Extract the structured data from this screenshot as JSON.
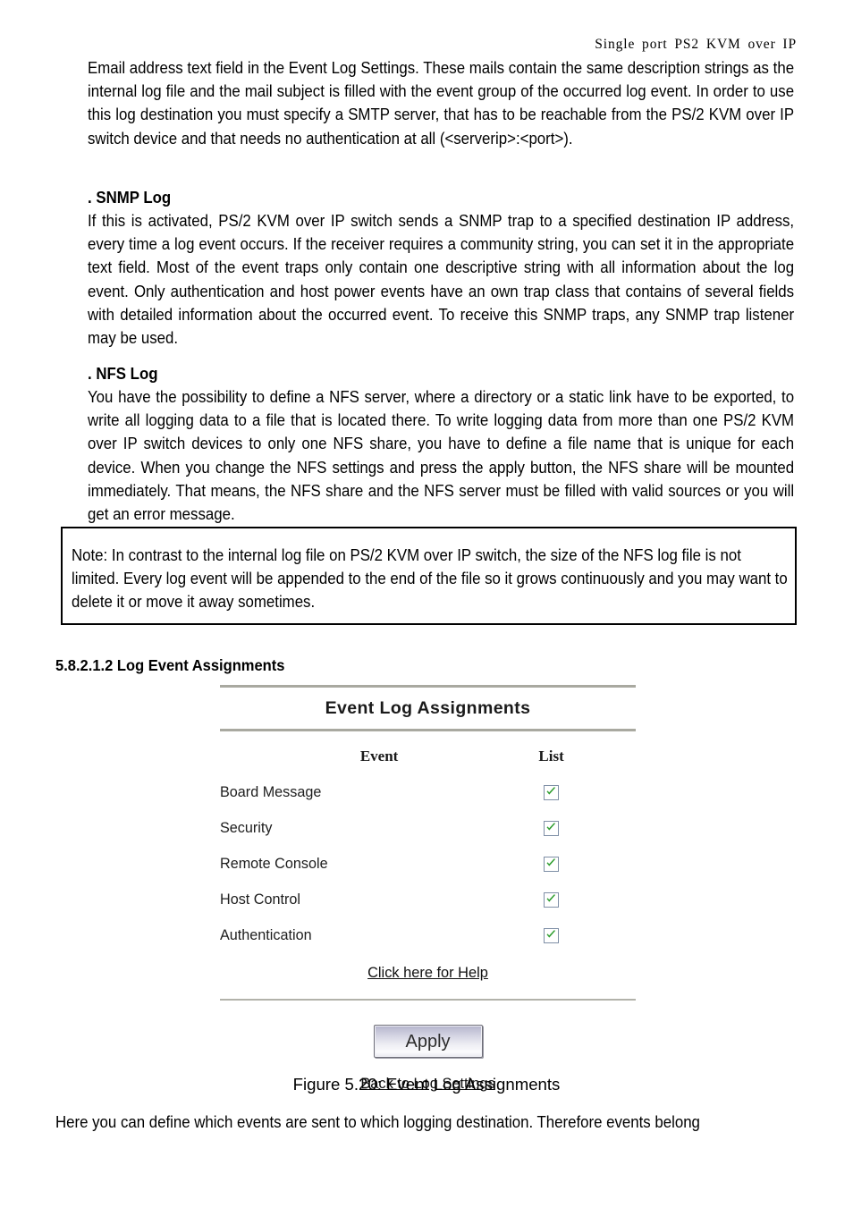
{
  "page": {
    "running_header": "Single port PS2 KVM over IP"
  },
  "paragraphs": {
    "p1": "Email address text field in the Event Log Settings. These mails contain the same description strings as the internal log file and the mail subject is filled with the event group of the occurred log event. In order to use this log destination you must specify a SMTP server, that has to be reachable from the PS/2 KVM over IP switch device and that needs no authentication at all (<serverip>:<port>).",
    "snmp_heading": ". SNMP Log",
    "p2": "If this is activated, PS/2 KVM over IP switch sends a SNMP trap to a specified destination IP address, every time a log event occurs. If the receiver requires a community string, you can set it in the appropriate text field. Most of the event traps only contain one descriptive string with all information about the log event. Only authentication and host power events have an own trap class that contains of several fields with detailed information about the occurred event. To receive this SNMP traps, any SNMP trap listener may be used.",
    "nfs_heading": ". NFS Log",
    "p3": "You have the possibility to define a NFS server, where a directory or a static link have to be exported, to write all logging data to a file that is located there. To write logging data from more than one PS/2 KVM over IP switch devices to only one NFS share, you have to define a file name that is unique for each device. When you change the NFS settings and press the apply button, the NFS share will be mounted immediately. That means, the NFS share and the NFS server must be filled with valid sources or you will get an error message.",
    "closing": "Here you can define which events are sent to which logging destination. Therefore events belong"
  },
  "note": {
    "text": "Note: In contrast to the internal log file on PS/2 KVM over IP switch, the size of the NFS log file is not limited. Every log event will be appended to the end of the file so it grows continuously and you may want to delete it or move it away sometimes."
  },
  "section": {
    "heading": "5.8.2.1.2 Log Event Assignments"
  },
  "figure": {
    "title": "Event Log Assignments",
    "columns": {
      "event": "Event",
      "list": "List"
    },
    "rows": [
      {
        "label": "Board Message",
        "checked": true
      },
      {
        "label": "Security",
        "checked": true
      },
      {
        "label": "Remote Console",
        "checked": true
      },
      {
        "label": "Host Control",
        "checked": true
      },
      {
        "label": "Authentication",
        "checked": true
      }
    ],
    "help_link": "Click here for Help",
    "apply_label": "Apply",
    "back_link": "Back to Log Settings",
    "caption": "Figure 5.20: Event Log Assignments",
    "colors": {
      "rule": "#a9a9a0",
      "check": "#2f9e2f",
      "checkbox_border": "#7f8fa6",
      "button_top": "#b4b4cc",
      "button_bottom": "#fbfbfd"
    }
  }
}
